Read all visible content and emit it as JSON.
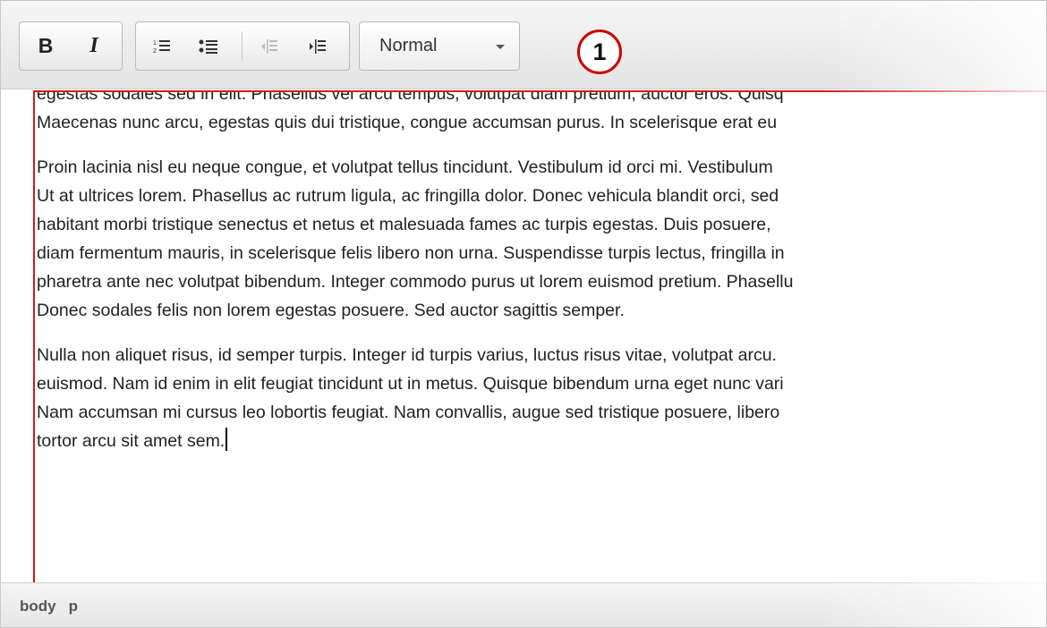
{
  "toolbar": {
    "bold_label": "B",
    "italic_label": "I",
    "format_select": {
      "value": "Normal"
    }
  },
  "callout": {
    "number": "1"
  },
  "content": {
    "paragraphs": [
      {
        "lines": [
          "egestas sodales sed in elit. Phasellus vel arcu tempus, volutpat diam pretium, auctor eros. Quisq",
          "Maecenas nunc arcu, egestas quis dui tristique, congue accumsan purus. In scelerisque erat eu"
        ]
      },
      {
        "lines": [
          "Proin lacinia nisl eu neque congue, et volutpat tellus tincidunt. Vestibulum id orci mi. Vestibulum",
          "Ut at ultrices lorem. Phasellus ac rutrum ligula, ac fringilla dolor. Donec vehicula blandit orci, sed",
          "habitant morbi tristique senectus et netus et malesuada fames ac turpis egestas. Duis posuere,",
          "diam fermentum mauris, in scelerisque felis libero non urna. Suspendisse turpis lectus, fringilla in",
          "pharetra ante nec volutpat bibendum. Integer commodo purus ut lorem euismod pretium. Phasellu",
          "Donec sodales felis non lorem egestas posuere. Sed auctor sagittis semper."
        ]
      },
      {
        "lines": [
          "Nulla non aliquet risus, id semper turpis. Integer id turpis varius, luctus risus vitae, volutpat arcu.",
          "euismod. Nam id enim in elit feugiat tincidunt ut in metus. Quisque bibendum urna eget nunc vari",
          "Nam accumsan mi cursus leo lobortis feugiat. Nam convallis, augue sed tristique posuere, libero",
          "tortor arcu sit amet sem."
        ]
      }
    ]
  },
  "statusbar": {
    "path": [
      "body",
      "p"
    ]
  },
  "colors": {
    "annotation_red": "#cc0000",
    "text": "#222222",
    "toolbar_bg": "#e9e9e9"
  }
}
